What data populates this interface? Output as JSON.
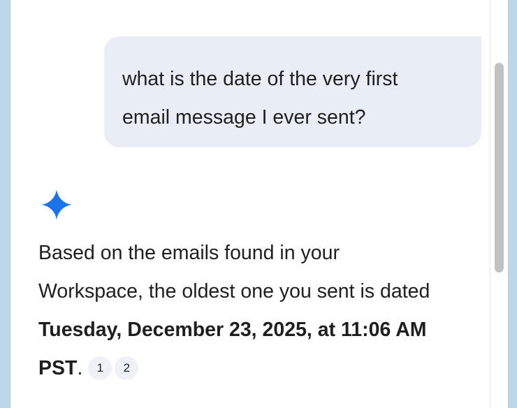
{
  "colors": {
    "bubble_bg": "#e9eef6",
    "spark": "#1a73e8",
    "text": "#1f1f1f",
    "citation_bg": "#eef1f6",
    "scrollbar_thumb": "#c1c1c1"
  },
  "chat": {
    "user_message": {
      "line1": "what is the date of the very first",
      "line2": "email message I ever sent?"
    },
    "assistant": {
      "icon": "gemini-spark-icon",
      "text_line1": "Based on the emails found in your",
      "text_line2": "Workspace, the oldest one you sent is dated",
      "bold_line": "Tuesday, December 23, 2025, at 11:06 AM",
      "bold_tail": "PST",
      "period": ".",
      "citations": [
        "1",
        "2"
      ]
    }
  }
}
